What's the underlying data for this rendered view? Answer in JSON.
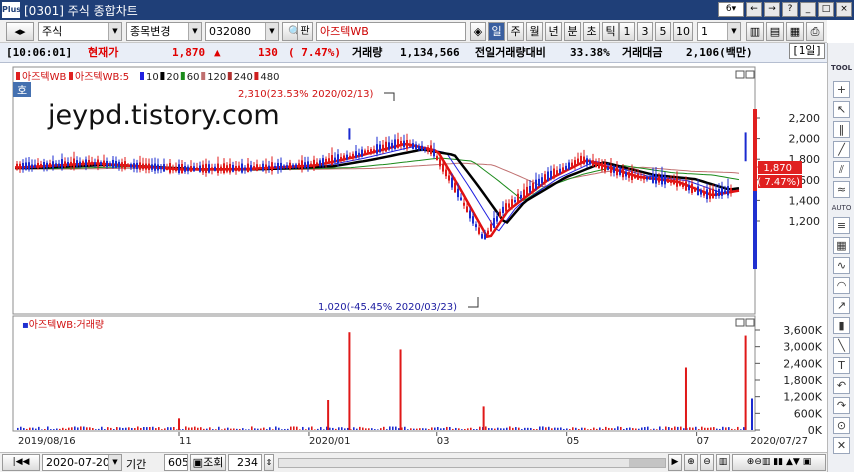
{
  "window": {
    "title": "[0301] 주식 종합차트",
    "screen_num": "6",
    "logo": "Plus"
  },
  "toolbar": {
    "market": "주식",
    "search_label": "종목변경",
    "code": "032080",
    "pan_label": "판",
    "stock_name": "아즈텍WB",
    "periods": [
      "일",
      "주",
      "월",
      "년",
      "분",
      "초",
      "틱"
    ],
    "active_period": "일",
    "intervals": [
      "1",
      "3",
      "5",
      "10"
    ],
    "interval_value": "1"
  },
  "infobar": {
    "time": "[10:06:01]",
    "price_label": "현재가",
    "price": "1,870",
    "arrow": "▲",
    "change": "130",
    "change_pct": "( 7.47%)",
    "volume_label": "거래량",
    "volume": "1,134,566",
    "prevvol_label": "전일거래량대비",
    "prevvol": "33.38%",
    "amount_label": "거래대금",
    "amount": "2,106(백만)",
    "period_select": "[1일]"
  },
  "price_panel": {
    "corner_label": "호",
    "watermark": "jeypd.tistory.com",
    "high_annotation": "2,310(23.53% 2020/02/13)",
    "low_annotation": "1,020(-45.45% 2020/03/23)",
    "legend": [
      {
        "label": "아즈텍WB",
        "color": "#e02020"
      },
      {
        "label": "아즈텍WB:5",
        "color": "#e02020"
      },
      {
        "label": "10",
        "color": "#2020e0"
      },
      {
        "label": "20",
        "color": "#000000"
      },
      {
        "label": "60",
        "color": "#1a8a1a"
      },
      {
        "label": "120",
        "color": "#c07070"
      },
      {
        "label": "240",
        "color": "#b03030"
      },
      {
        "label": "480",
        "color": "#d02020"
      }
    ],
    "price_box": "1,870",
    "pct_box": "( 7.47%)"
  },
  "volume_panel": {
    "legend": "아즈텍WB:거래량"
  },
  "bottombar": {
    "date": "2020-07-20",
    "period_label": "기간",
    "period_value": "605",
    "view_label": "조회",
    "count": "234"
  },
  "sidebar": {
    "tool_label": "TOOL",
    "auto_label": "AUTO"
  },
  "chart_data": [
    {
      "type": "line",
      "title": "아즈텍WB",
      "x_range": [
        "2019/08/16",
        "2020/07/27"
      ],
      "x_ticks": [
        "2019/08/16",
        "11",
        "2020/01",
        "03",
        "05",
        "07",
        "2020/07/27"
      ],
      "y_ticks": [
        "2,200",
        "2,000",
        "1,800",
        "1,600",
        "1,400",
        "1,200"
      ],
      "ylim": [
        1020,
        2310
      ],
      "series": [
        {
          "name": "아즈텍WB",
          "x": [
            "2019/08/16",
            "2019/09/20",
            "2019/11/01",
            "2019/12/01",
            "2020/01/02",
            "2020/01/20",
            "2020/02/13",
            "2020/02/28",
            "2020/03/10",
            "2020/03/23",
            "2020/04/01",
            "2020/04/20",
            "2020/05/08",
            "2020/06/01",
            "2020/06/20",
            "2020/07/06",
            "2020/07/20",
            "2020/07/27"
          ],
          "values": [
            1720,
            1760,
            1700,
            1705,
            1740,
            1820,
            1950,
            1880,
            1500,
            1020,
            1300,
            1600,
            1790,
            1630,
            1580,
            1450,
            1500,
            1870
          ]
        }
      ]
    },
    {
      "type": "bar",
      "title": "아즈텍WB:거래량",
      "y_ticks": [
        "3,600K",
        "3,000K",
        "2,400K",
        "1,800K",
        "1,200K",
        "600K",
        "0K"
      ],
      "ylim": [
        0,
        3800000
      ],
      "spikes": [
        {
          "x": "2019/11/01",
          "value": 420000
        },
        {
          "x": "2020/01/10",
          "value": 1080000
        },
        {
          "x": "2020/01/20",
          "value": 3520000
        },
        {
          "x": "2020/02/13",
          "value": 2900000
        },
        {
          "x": "2020/03/23",
          "value": 850000
        },
        {
          "x": "2020/06/26",
          "value": 2250000
        },
        {
          "x": "2020/07/24",
          "value": 3400000
        },
        {
          "x": "2020/07/27",
          "value": 1134566
        }
      ]
    }
  ]
}
